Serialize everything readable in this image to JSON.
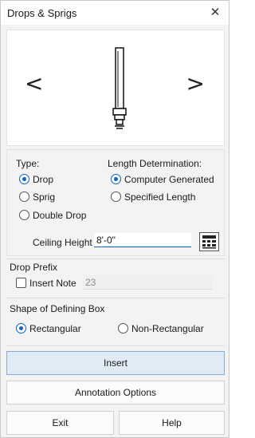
{
  "window": {
    "title": "Drops & Sprigs",
    "close_glyph": "✕"
  },
  "preview": {
    "prev_glyph": "<",
    "next_glyph": ">"
  },
  "type": {
    "heading": "Type:",
    "options": [
      {
        "label": "Drop",
        "selected": true
      },
      {
        "label": "Sprig",
        "selected": false
      },
      {
        "label": "Double Drop",
        "selected": false
      }
    ]
  },
  "length": {
    "heading": "Length Determination:",
    "options": [
      {
        "label": "Computer Generated",
        "selected": true
      },
      {
        "label": "Specified Length",
        "selected": false
      }
    ]
  },
  "ceiling": {
    "label": "Ceiling Height",
    "value": "8'-0\"",
    "calc_icon": "calculator-icon"
  },
  "prefix": {
    "heading": "Drop Prefix",
    "insert_note_label": "Insert Note",
    "insert_note_checked": false,
    "note_value": "23"
  },
  "shape": {
    "heading": "Shape of Defining Box",
    "options": [
      {
        "label": "Rectangular",
        "selected": true
      },
      {
        "label": "Non-Rectangular",
        "selected": false
      }
    ]
  },
  "buttons": {
    "insert": "Insert",
    "annotation": "Annotation Options",
    "exit": "Exit",
    "help": "Help"
  },
  "colors": {
    "accent": "#0f62c4",
    "primary_button": "#e1ebf6"
  }
}
